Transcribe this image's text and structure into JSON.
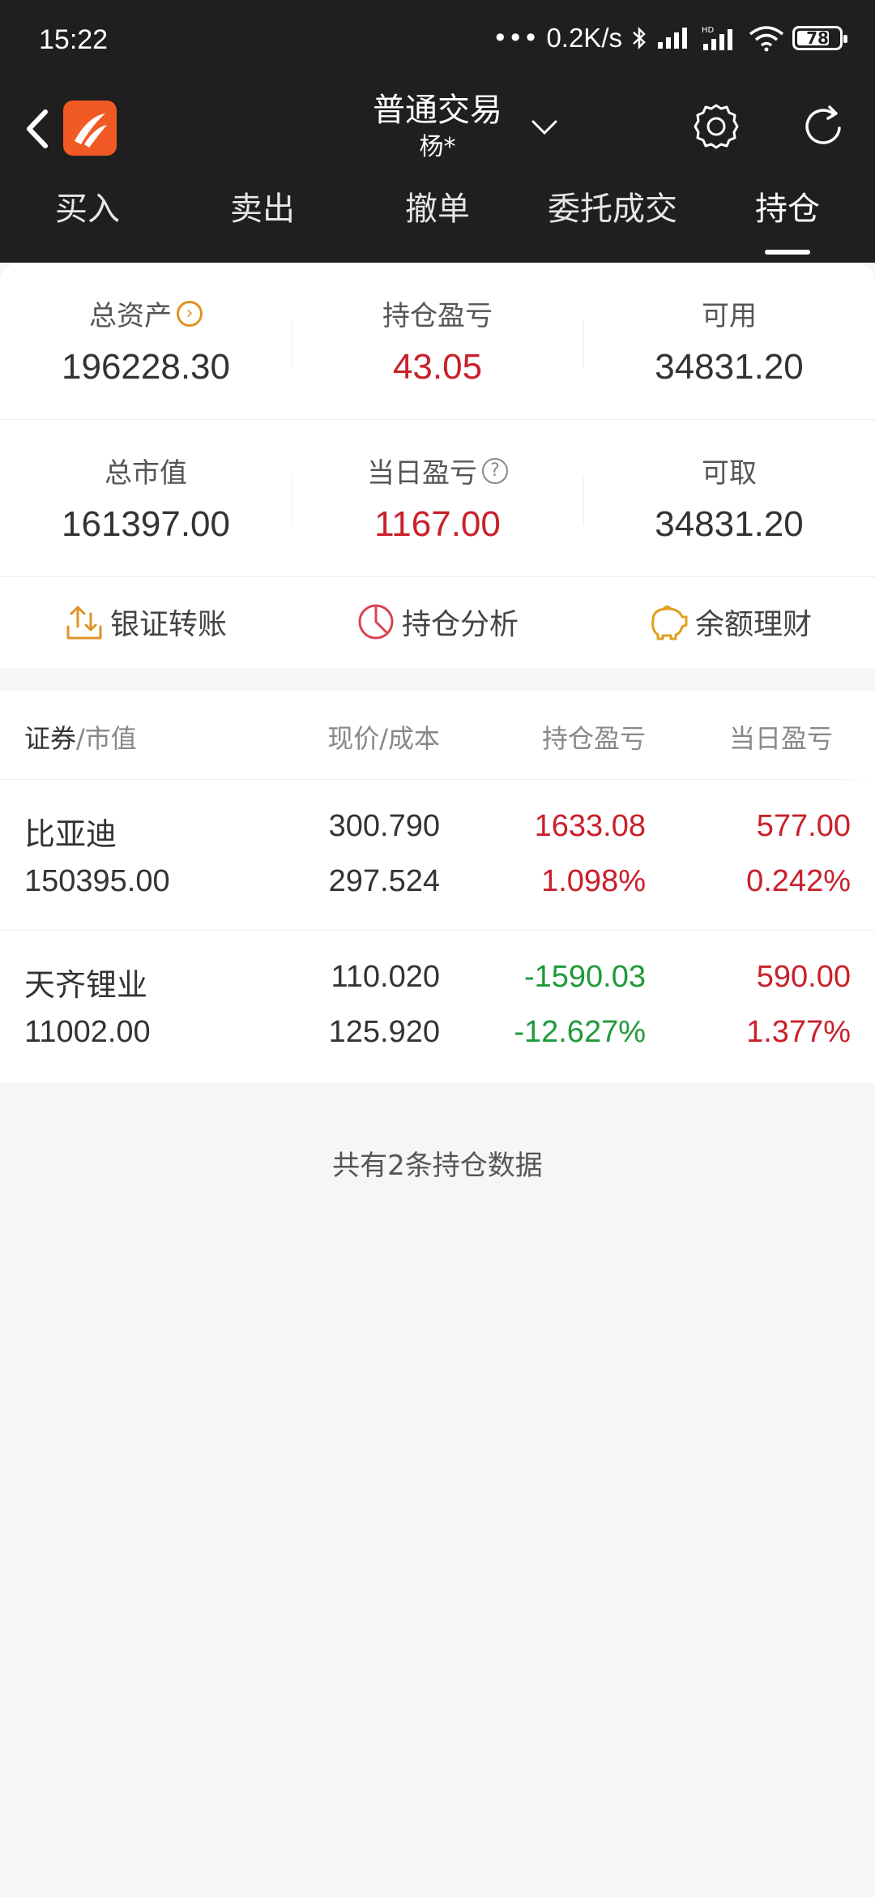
{
  "status_bar": {
    "time": "15:22",
    "speed": "0.2K/s",
    "battery": "78",
    "battery_level": 0.78
  },
  "header": {
    "title": "普通交易",
    "account": "杨*"
  },
  "tabs": [
    {
      "label": "买入",
      "active": false
    },
    {
      "label": "卖出",
      "active": false
    },
    {
      "label": "撤单",
      "active": false
    },
    {
      "label": "委托成交",
      "active": false
    },
    {
      "label": "持仓",
      "active": true
    }
  ],
  "summary": {
    "total_assets_label": "总资产",
    "total_assets": "196228.30",
    "position_pl_label": "持仓盈亏",
    "position_pl": "43.05",
    "available_label": "可用",
    "available": "34831.20",
    "market_value_label": "总市值",
    "market_value": "161397.00",
    "daily_pl_label": "当日盈亏",
    "daily_pl": "1167.00",
    "withdrawable_label": "可取",
    "withdrawable": "34831.20"
  },
  "actions": {
    "bank_transfer": "银证转账",
    "position_analysis": "持仓分析",
    "balance_finance": "余额理财"
  },
  "table": {
    "col_security": "证券",
    "col_market_value": "/市值",
    "col_price": "现价/成本",
    "col_position_pl": "持仓盈亏",
    "col_daily_pl": "当日盈亏",
    "rows": [
      {
        "name": "比亚迪",
        "market_value": "150395.00",
        "price": "300.790",
        "cost": "297.524",
        "pl": "1633.08",
        "pl_pct": "1.098%",
        "day_pl": "577.00",
        "day_pct": "0.242%"
      },
      {
        "name": "天齐锂业",
        "market_value": "11002.00",
        "price": "110.020",
        "cost": "125.920",
        "pl": "-1590.03",
        "pl_pct": "-12.627%",
        "day_pl": "590.00",
        "day_pct": "1.377%"
      }
    ]
  },
  "footer_note": "共有2条持仓数据",
  "colors": {
    "red": "#c9202b",
    "green": "#1e9a3a",
    "accent": "#f15a24",
    "header_bg": "#1f1f1f"
  }
}
